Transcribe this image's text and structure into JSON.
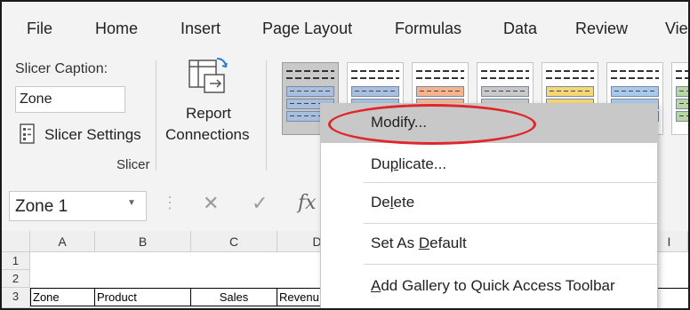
{
  "ribbon": {
    "tabs": [
      "File",
      "Home",
      "Insert",
      "Page Layout",
      "Formulas",
      "Data",
      "Review",
      "Vie"
    ],
    "slicer_group": {
      "caption_label": "Slicer Caption:",
      "caption_value": "Zone",
      "settings_label": "Slicer Settings",
      "report_line1": "Report",
      "report_line2": "Connections",
      "group_name": "Slicer"
    },
    "styles_gallery": {
      "colors": [
        "#a8bfe0",
        "#a8bfe0",
        "#f5b48e",
        "#c8c8c8",
        "#f7d774",
        "#a8c8ec",
        "#b9d6a2"
      ]
    }
  },
  "formula_bar": {
    "name_box": "Zone 1",
    "cancel_glyph": "✕",
    "enter_glyph": "✓",
    "fx_glyph": "fx"
  },
  "sheet": {
    "columns": [
      "A",
      "B",
      "C",
      "D",
      "I"
    ],
    "rows": [
      "1",
      "2",
      "3"
    ],
    "row3": [
      "Zone",
      "Product",
      "Sales",
      "Revenu"
    ]
  },
  "context_menu": {
    "items": [
      {
        "pre": "Modify",
        "u": "",
        "post": "...",
        "highlighted": true
      },
      {
        "pre": "Du",
        "u": "p",
        "post": "licate...",
        "highlighted": false
      },
      {
        "pre": "De",
        "u": "l",
        "post": "ete",
        "highlighted": false
      },
      {
        "pre": "Set As ",
        "u": "D",
        "post": "efault",
        "highlighted": false
      },
      {
        "pre": "",
        "u": "A",
        "post": "dd Gallery to Quick Access Toolbar",
        "highlighted": false
      }
    ]
  },
  "annotation_color": "#e0262c"
}
